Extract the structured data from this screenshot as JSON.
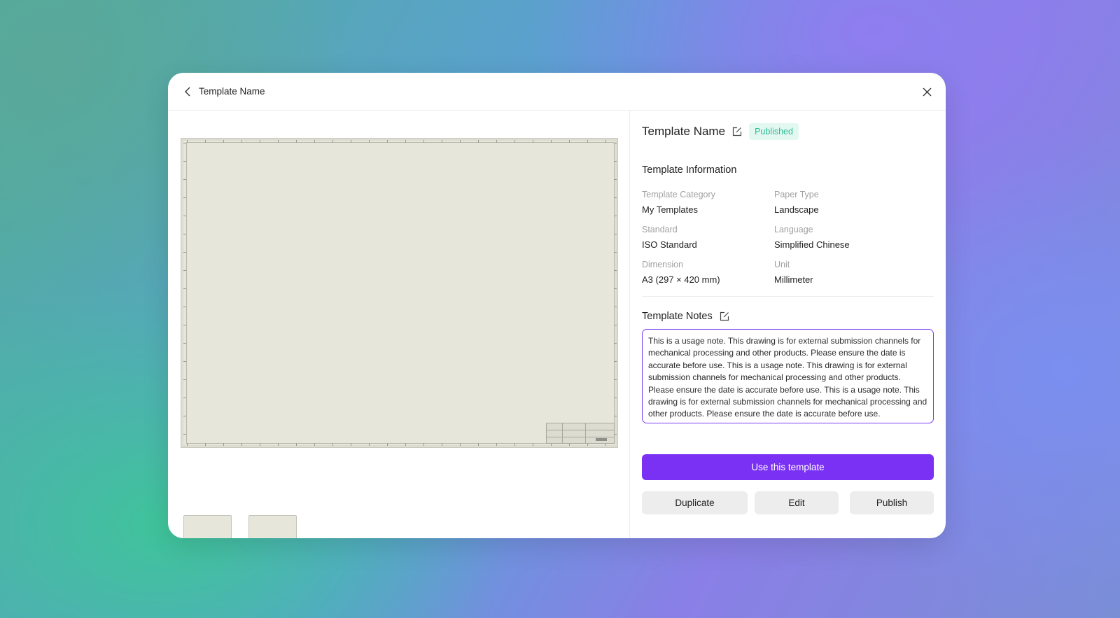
{
  "header": {
    "title": "Template Name"
  },
  "template": {
    "name": "Template Name",
    "status": "Published"
  },
  "info": {
    "section_title": "Template Information",
    "fields": [
      {
        "label": "Template Category",
        "value": "My Templates"
      },
      {
        "label": "Paper Type",
        "value": "Landscape"
      },
      {
        "label": "Standard",
        "value": "ISO Standard"
      },
      {
        "label": "Language",
        "value": "Simplified Chinese"
      },
      {
        "label": "Dimension",
        "value": "A3 (297 × 420 mm)"
      },
      {
        "label": "Unit",
        "value": "Millimeter"
      }
    ]
  },
  "notes": {
    "title": "Template Notes",
    "text": "This is a usage note. This drawing is for external submission channels for mechanical processing and other products. Please ensure the date is accurate before use. This is a usage note. This drawing is for external submission channels for mechanical processing and other products. Please ensure the date is accurate before use. This is a usage note. This drawing is for external submission channels for mechanical processing and other products. Please ensure the date is accurate before use."
  },
  "actions": {
    "primary": "Use this template",
    "duplicate": "Duplicate",
    "edit": "Edit",
    "publish": "Publish"
  },
  "icons": {
    "back": "chevron-left-icon",
    "close": "close-icon",
    "edit": "edit-icon"
  },
  "colors": {
    "accent": "#7b31f4",
    "status_bg": "#e3f8f1",
    "status_text": "#2ebb95",
    "paper": "#e7e6da"
  }
}
